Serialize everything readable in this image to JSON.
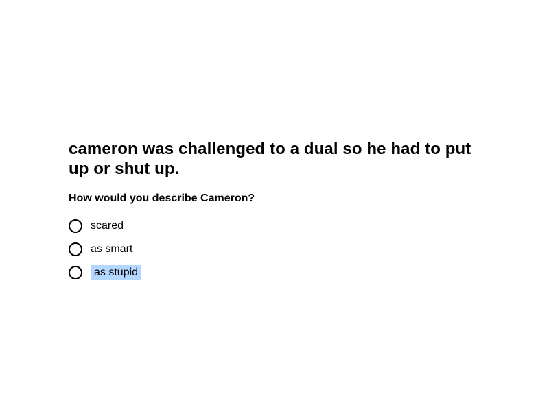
{
  "prompt": {
    "title": "cameron was challenged to a dual so he had to put up or shut up.",
    "question": "How would you describe Cameron?"
  },
  "options": [
    {
      "label": "scared",
      "highlighted": false
    },
    {
      "label": "as smart",
      "highlighted": false
    },
    {
      "label": "as stupid",
      "highlighted": true
    }
  ],
  "colors": {
    "text": "#000000",
    "background": "#ffffff",
    "selection_highlight": "#b3d7ff"
  }
}
